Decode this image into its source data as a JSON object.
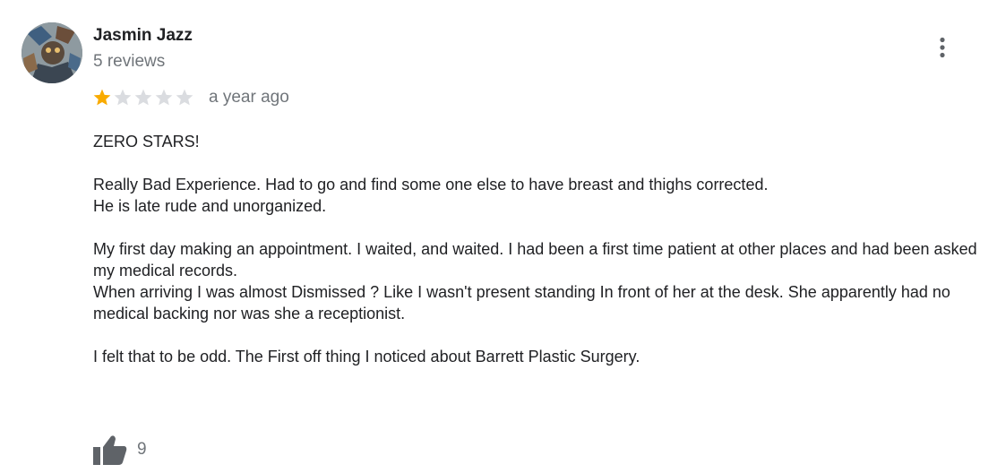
{
  "review": {
    "author": {
      "name": "Jasmin Jazz",
      "meta": "5 reviews",
      "avatar_icon": "profile-photo"
    },
    "rating": {
      "value": 1,
      "max": 5,
      "filled_color": "#f9ab00",
      "empty_color": "#dadce0"
    },
    "date": "a year ago",
    "body": {
      "paragraphs": [
        "ZERO STARS!",
        "Really Bad Experience. Had to go and find some one else to have breast and thighs corrected.\nHe is late rude and unorganized.",
        "My first day making an appointment. I waited, and waited. I had been a first time patient at other places and had been asked my medical records.\nWhen arriving I was almost Dismissed ? Like I wasn't present standing In  front of her at the desk. She apparently had no medical backing nor was she a receptionist.",
        "I felt that to be odd. The First off thing I noticed about Barrett Plastic Surgery."
      ]
    },
    "likes": {
      "count": "9",
      "icon": "thumbs-up-icon"
    },
    "menu_icon": "more-vert-icon"
  }
}
